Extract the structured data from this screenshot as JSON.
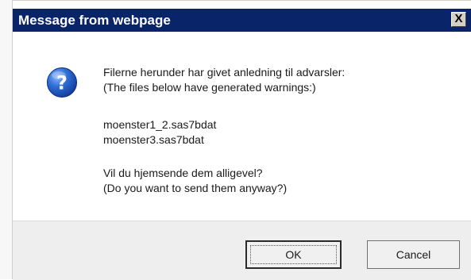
{
  "dialog": {
    "title": "Message from webpage",
    "close_label": "X",
    "icon": "question-icon",
    "title_bar_color": "#0a246a"
  },
  "message": {
    "intro_line_1": "Filerne herunder har givet anledning til advarsler:",
    "intro_line_2": "(The files below have generated warnings:)",
    "files": [
      "moenster1_2.sas7bdat",
      "moenster3.sas7bdat"
    ],
    "question_line_1": "Vil du hjemsende dem alligevel?",
    "question_line_2": "(Do you want to send them anyway?)"
  },
  "buttons": {
    "ok_label": "OK",
    "cancel_label": "Cancel"
  }
}
